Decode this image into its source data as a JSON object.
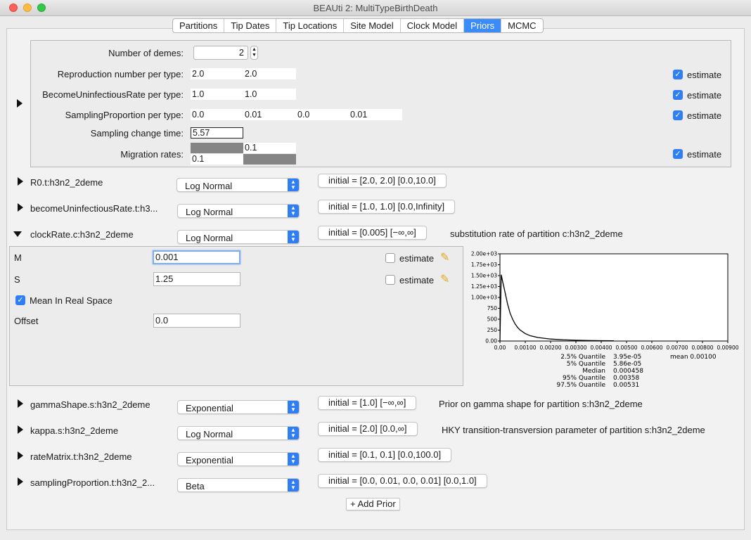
{
  "window": {
    "title": "BEAUti 2: MultiTypeBirthDeath"
  },
  "tabs": [
    "Partitions",
    "Tip Dates",
    "Tip Locations",
    "Site Model",
    "Clock Model",
    "Priors",
    "MCMC"
  ],
  "demes": {
    "num_label": "Number of demes:",
    "num_value": "2",
    "r_label": "Reproduction number per type:",
    "r_values": [
      "2.0",
      "2.0"
    ],
    "bu_label": "BecomeUninfectiousRate per type:",
    "bu_values": [
      "1.0",
      "1.0"
    ],
    "sp_label": "SamplingProportion per type:",
    "sp_values": [
      "0.0",
      "0.01",
      "0.0",
      "0.01"
    ],
    "sct_label": "Sampling change time:",
    "sct_value": "5.57",
    "mig_label": "Migration rates:",
    "mig_values": [
      "0.1",
      "0.1"
    ],
    "estimate": "estimate"
  },
  "priors": [
    {
      "name": "R0.t:h3n2_2deme",
      "dist": "Log Normal",
      "initial": "initial = [2.0, 2.0] [0.0,10.0]",
      "desc": ""
    },
    {
      "name": "becomeUninfectiousRate.t:h3...",
      "dist": "Log Normal",
      "initial": "initial = [1.0, 1.0] [0.0,Infinity]",
      "desc": ""
    },
    {
      "name": "clockRate.c:h3n2_2deme",
      "dist": "Log Normal",
      "initial": "initial = [0.005] [−∞,∞]",
      "desc": "substitution rate of partition c:h3n2_2deme"
    },
    {
      "name": "gammaShape.s:h3n2_2deme",
      "dist": "Exponential",
      "initial": "initial = [1.0] [−∞,∞]",
      "desc": "Prior on gamma shape for partition s:h3n2_2deme"
    },
    {
      "name": "kappa.s:h3n2_2deme",
      "dist": "Log Normal",
      "initial": "initial = [2.0] [0.0,∞]",
      "desc": "HKY transition-transversion parameter of partition s:h3n2_2deme"
    },
    {
      "name": "rateMatrix.t:h3n2_2deme",
      "dist": "Exponential",
      "initial": "initial = [0.1, 0.1] [0.0,100.0]",
      "desc": ""
    },
    {
      "name": "samplingProportion.t:h3n2_2...",
      "dist": "Beta",
      "initial": "initial = [0.0, 0.01, 0.0, 0.01] [0.0,1.0]",
      "desc": ""
    }
  ],
  "clock": {
    "m_label": "M",
    "m_value": "0.001",
    "s_label": "S",
    "s_value": "1.25",
    "mean_real": "Mean In Real Space",
    "offset_label": "Offset",
    "offset_value": "0.0",
    "estimate": "estimate"
  },
  "add_prior": "+ Add Prior",
  "colors": {
    "accent": "#2f7ef6",
    "tab_active": "#3b8cf8"
  },
  "chart_data": {
    "type": "line",
    "x": [
      0.0,
      5e-05,
      0.0001,
      0.0002,
      0.0003,
      0.0004,
      0.0005,
      0.0006,
      0.0007,
      0.0008,
      0.001,
      0.0012,
      0.0015,
      0.002,
      0.0025,
      0.003,
      0.0035,
      0.004,
      0.0045
    ],
    "y": [
      0,
      1520,
      1380,
      1120,
      850,
      640,
      500,
      390,
      310,
      250,
      170,
      120,
      80,
      45,
      28,
      18,
      12,
      8,
      5
    ],
    "xticks": [
      "0.00",
      "0.00100",
      "0.00200",
      "0.00300",
      "0.00400",
      "0.00500",
      "0.00600",
      "0.00700",
      "0.00800",
      "0.00900"
    ],
    "yticks": [
      "0.00",
      "250",
      "500",
      "750",
      "1.00e+03",
      "1.25e+03",
      "1.50e+03",
      "1.75e+03",
      "2.00e+03"
    ],
    "xlim": [
      0,
      0.009
    ],
    "ylim": [
      0,
      2000
    ],
    "stats": {
      "labels": [
        "2.5% Quantile",
        "5% Quantile",
        "Median",
        "95% Quantile",
        "97.5% Quantile"
      ],
      "values": [
        "3.95e-05",
        "5.86e-05",
        "0.000458",
        "0.00358",
        "0.00531"
      ],
      "mean": "mean 0.00100"
    }
  }
}
